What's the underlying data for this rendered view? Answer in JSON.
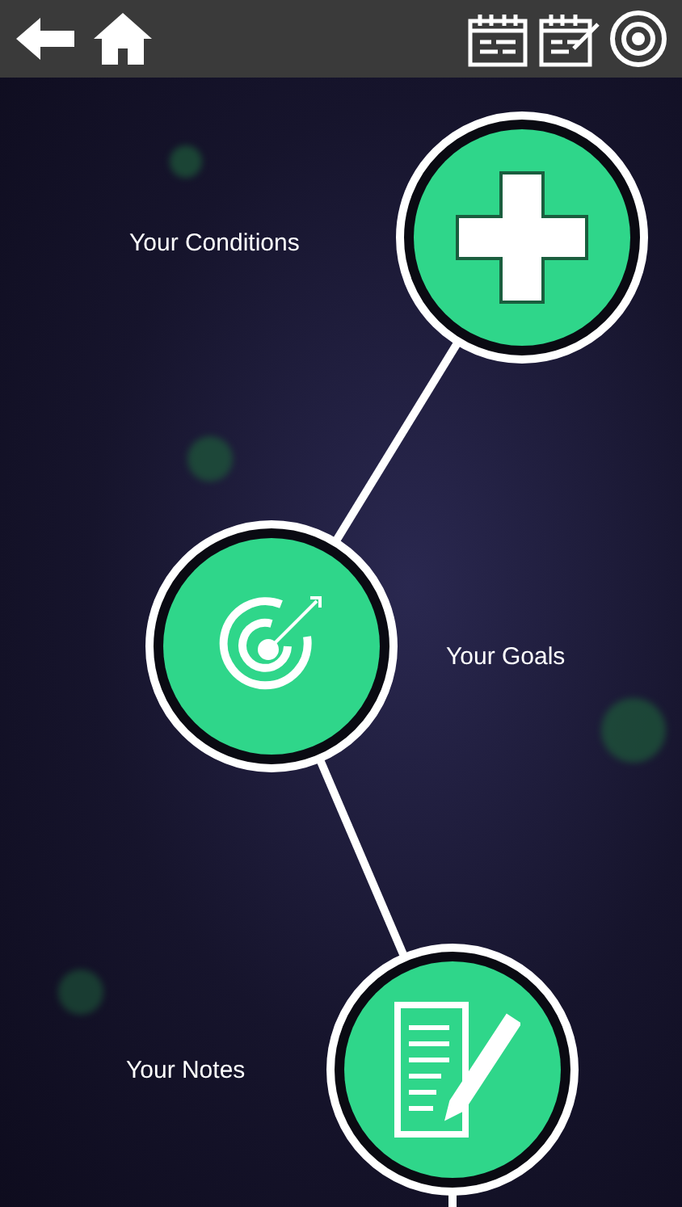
{
  "top_bar": {
    "buttons": [
      {
        "kind": "back"
      },
      {
        "kind": "home"
      },
      {
        "kind": "calendar"
      },
      {
        "kind": "calendar_edit"
      },
      {
        "kind": "target"
      }
    ]
  },
  "nodes": [
    {
      "kind": "conditions",
      "label": "Your Conditions"
    },
    {
      "kind": "goals",
      "label": "Your Goals"
    },
    {
      "kind": "notes",
      "label": "Your Notes"
    }
  ]
}
